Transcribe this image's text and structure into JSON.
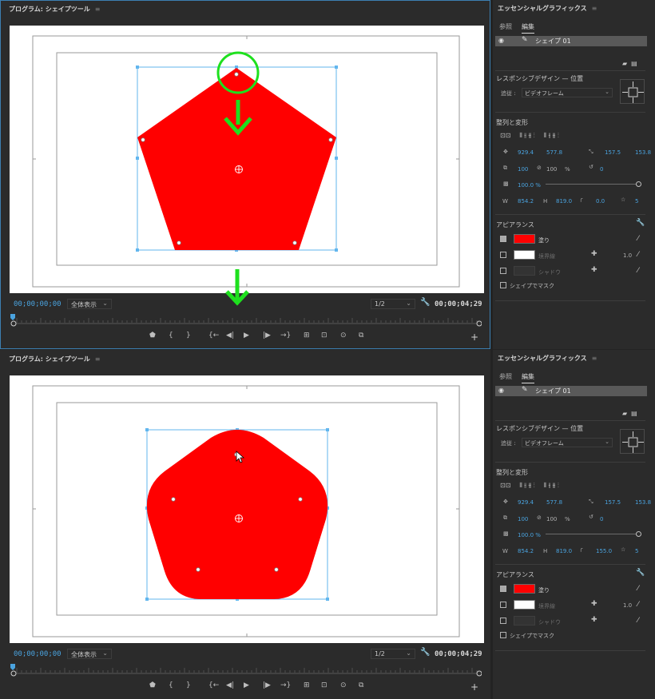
{
  "program": {
    "title": "プログラム: シェイプツール",
    "menu_icon": "≡",
    "timecode_current": "00;00;00;00",
    "zoom": "全体表示",
    "resolution": "1/2",
    "timecode_duration": "00;00;04;29",
    "transport_icons": [
      "marker-icon",
      "in-point-icon",
      "out-point-icon",
      "go-to-in-icon",
      "step-back-icon",
      "play-icon",
      "step-forward-icon",
      "go-to-out-icon",
      "insert-icon",
      "overwrite-icon",
      "export-frame-icon",
      "comparison-icon"
    ],
    "transport_glyphs": [
      "⬟",
      "{",
      "}",
      "{←",
      "◀|",
      "▶",
      "|▶",
      "→}",
      "⊞",
      "⊡",
      "⊙",
      "⧉"
    ]
  },
  "eg": {
    "title": "エッセンシャルグラフィックス",
    "menu_icon": "≡",
    "tabs": [
      "参照",
      "編集"
    ],
    "layer_name": "シェイプ 01",
    "responsive_title": "レスポンシブデザイン — 位置",
    "follow_label": "追従 :",
    "follow_value": "ビデオフレーム",
    "align_title": "整列と変形",
    "pos_x": "929.4",
    "pos_y": "577.8",
    "anchor_x": "157.5",
    "anchor_y": "153.8",
    "scale": "100",
    "scale2": "100",
    "percent": "%",
    "rotation": "0",
    "opacity": "100.0 %",
    "w_label": "W",
    "w_value": "854.2",
    "h_label": "H",
    "h_value": "819.0",
    "star_value": "5",
    "appearance_title": "アピアランス",
    "fill_label": "塗り",
    "stroke_label": "境界線",
    "stroke_width": "1.0",
    "shadow_label": "シャドウ",
    "mask_label": "シェイプでマスク",
    "fill_color": "#ff0000",
    "stroke_color": "#ffffff"
  },
  "top": {
    "roundness": "0.0"
  },
  "bottom": {
    "roundness": "155.0"
  },
  "colors": {
    "accent": "#4aa3df",
    "shape": "#ff0000",
    "annotation": "#00ee00"
  }
}
